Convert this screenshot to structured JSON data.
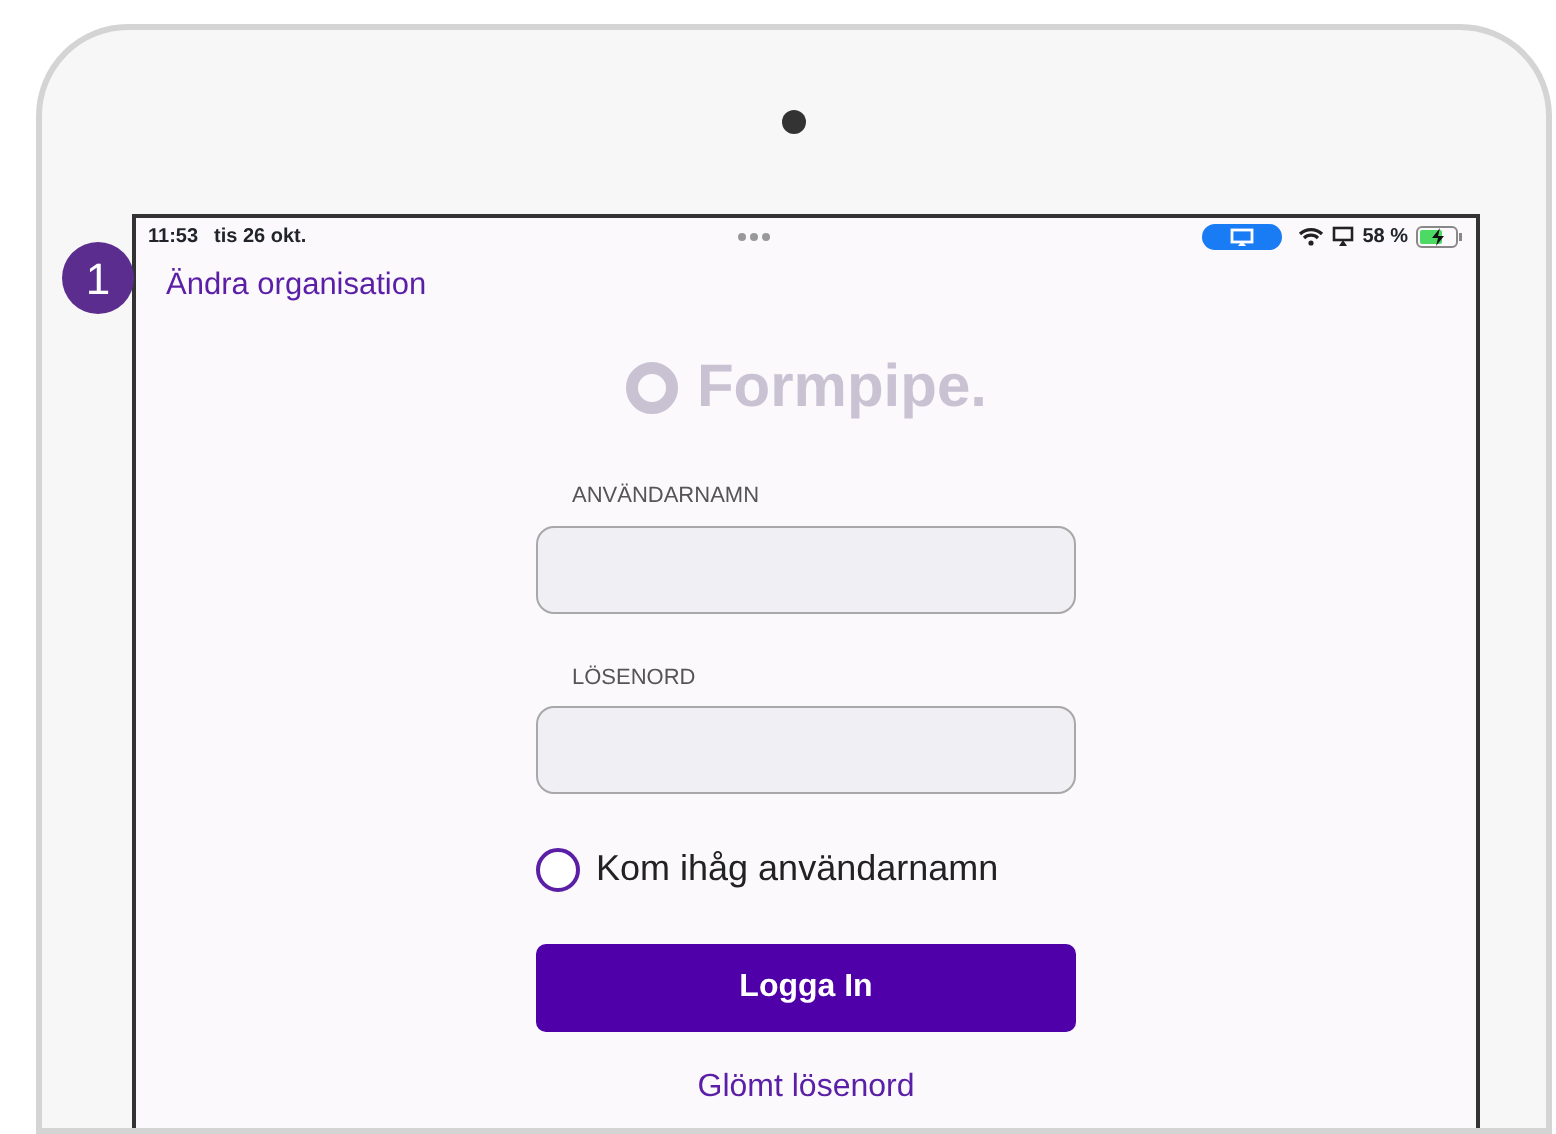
{
  "step_badge": "1",
  "status_bar": {
    "time": "11:53",
    "date": "tis 26 okt.",
    "battery": "58 %"
  },
  "change_org_link": "Ändra organisation",
  "logo": "Formpipe.",
  "fields": [
    {
      "label": "ANVÄNDARNAMN"
    },
    {
      "label": "LÖSENORD"
    }
  ],
  "remember": {
    "label": "Kom ihåg användarnamn",
    "checked": false
  },
  "login_button": "Logga In",
  "forgot_link": "Glömt lösenord"
}
